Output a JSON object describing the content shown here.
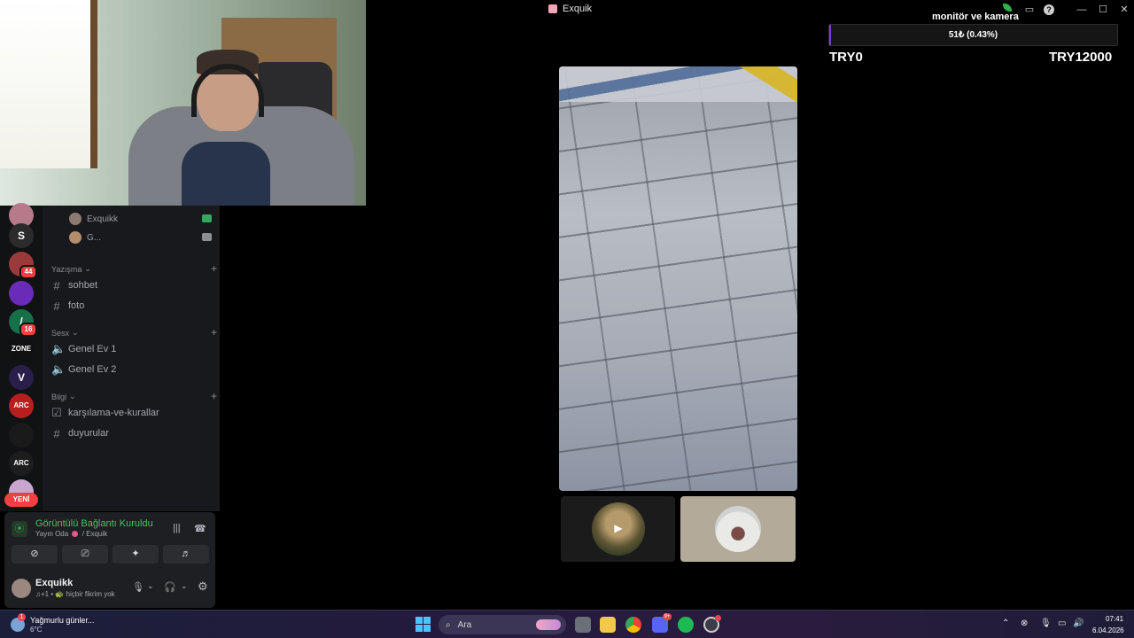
{
  "window": {
    "title": "Exquik"
  },
  "servers": [
    {
      "name": "server-1",
      "badge": "",
      "color": "#b77a8a",
      "glyph": ""
    },
    {
      "name": "server-2",
      "badge": "",
      "color": "#2b2b2b",
      "glyph": "S"
    },
    {
      "name": "server-3",
      "badge": "44",
      "color": "#9a3a3a",
      "glyph": ""
    },
    {
      "name": "server-4",
      "badge": "",
      "color": "#6a2bb8",
      "glyph": ""
    },
    {
      "name": "server-5",
      "badge": "16",
      "color": "#16704a",
      "glyph": "/"
    },
    {
      "name": "server-6",
      "badge": "",
      "color": "#111111",
      "glyph": "ZONE"
    },
    {
      "name": "server-7",
      "badge": "",
      "color": "#2a1f4a",
      "glyph": "V"
    },
    {
      "name": "server-8",
      "badge": "",
      "color": "#b81e1e",
      "glyph": "ARC"
    },
    {
      "name": "server-9",
      "badge": "",
      "color": "#1a1a1a",
      "glyph": ""
    },
    {
      "name": "server-10",
      "badge": "",
      "color": "#1d1d1d",
      "glyph": "ARC"
    },
    {
      "name": "server-11",
      "badge": "",
      "color": "#c8a6d0",
      "glyph": ""
    }
  ],
  "new_label": "YENİ",
  "voice_users": [
    {
      "name": "Exquikk"
    },
    {
      "name": "G..."
    }
  ],
  "categories": [
    {
      "label": "Yazışma",
      "channels": [
        {
          "name": "sohbet",
          "icon": "#"
        },
        {
          "name": "foto",
          "icon": "#"
        }
      ]
    },
    {
      "label": "Sesx",
      "channels": [
        {
          "name": "Genel Ev 1",
          "icon": "speaker"
        },
        {
          "name": "Genel Ev 2",
          "icon": "speaker"
        }
      ]
    },
    {
      "label": "Bilgi",
      "channels": [
        {
          "name": "karşılama-ve-kurallar",
          "icon": "rules"
        },
        {
          "name": "duyurular",
          "icon": "#"
        }
      ]
    }
  ],
  "voice_panel": {
    "status": "Görüntülü Bağlantı Kuruldu",
    "room": "Yayın Oda",
    "server": "/ Exquik"
  },
  "user": {
    "name": "Exquikk",
    "status": "♫+1 • 🐢 hiçbir fikrim yok"
  },
  "donation": {
    "label": "monitör ve kamera",
    "percent_text": "51₺ (0.43%)",
    "progress": 0.0043,
    "min": "TRY0",
    "max": "TRY12000",
    "accent": "#7b3fd6"
  },
  "taskbar": {
    "weather_title": "Yağmurlu günler...",
    "weather_temp": "6°C",
    "weather_badge": "1",
    "search_placeholder": "Ara",
    "discord_badge": "9+",
    "time": "07:41",
    "date": "6.04.2026"
  }
}
